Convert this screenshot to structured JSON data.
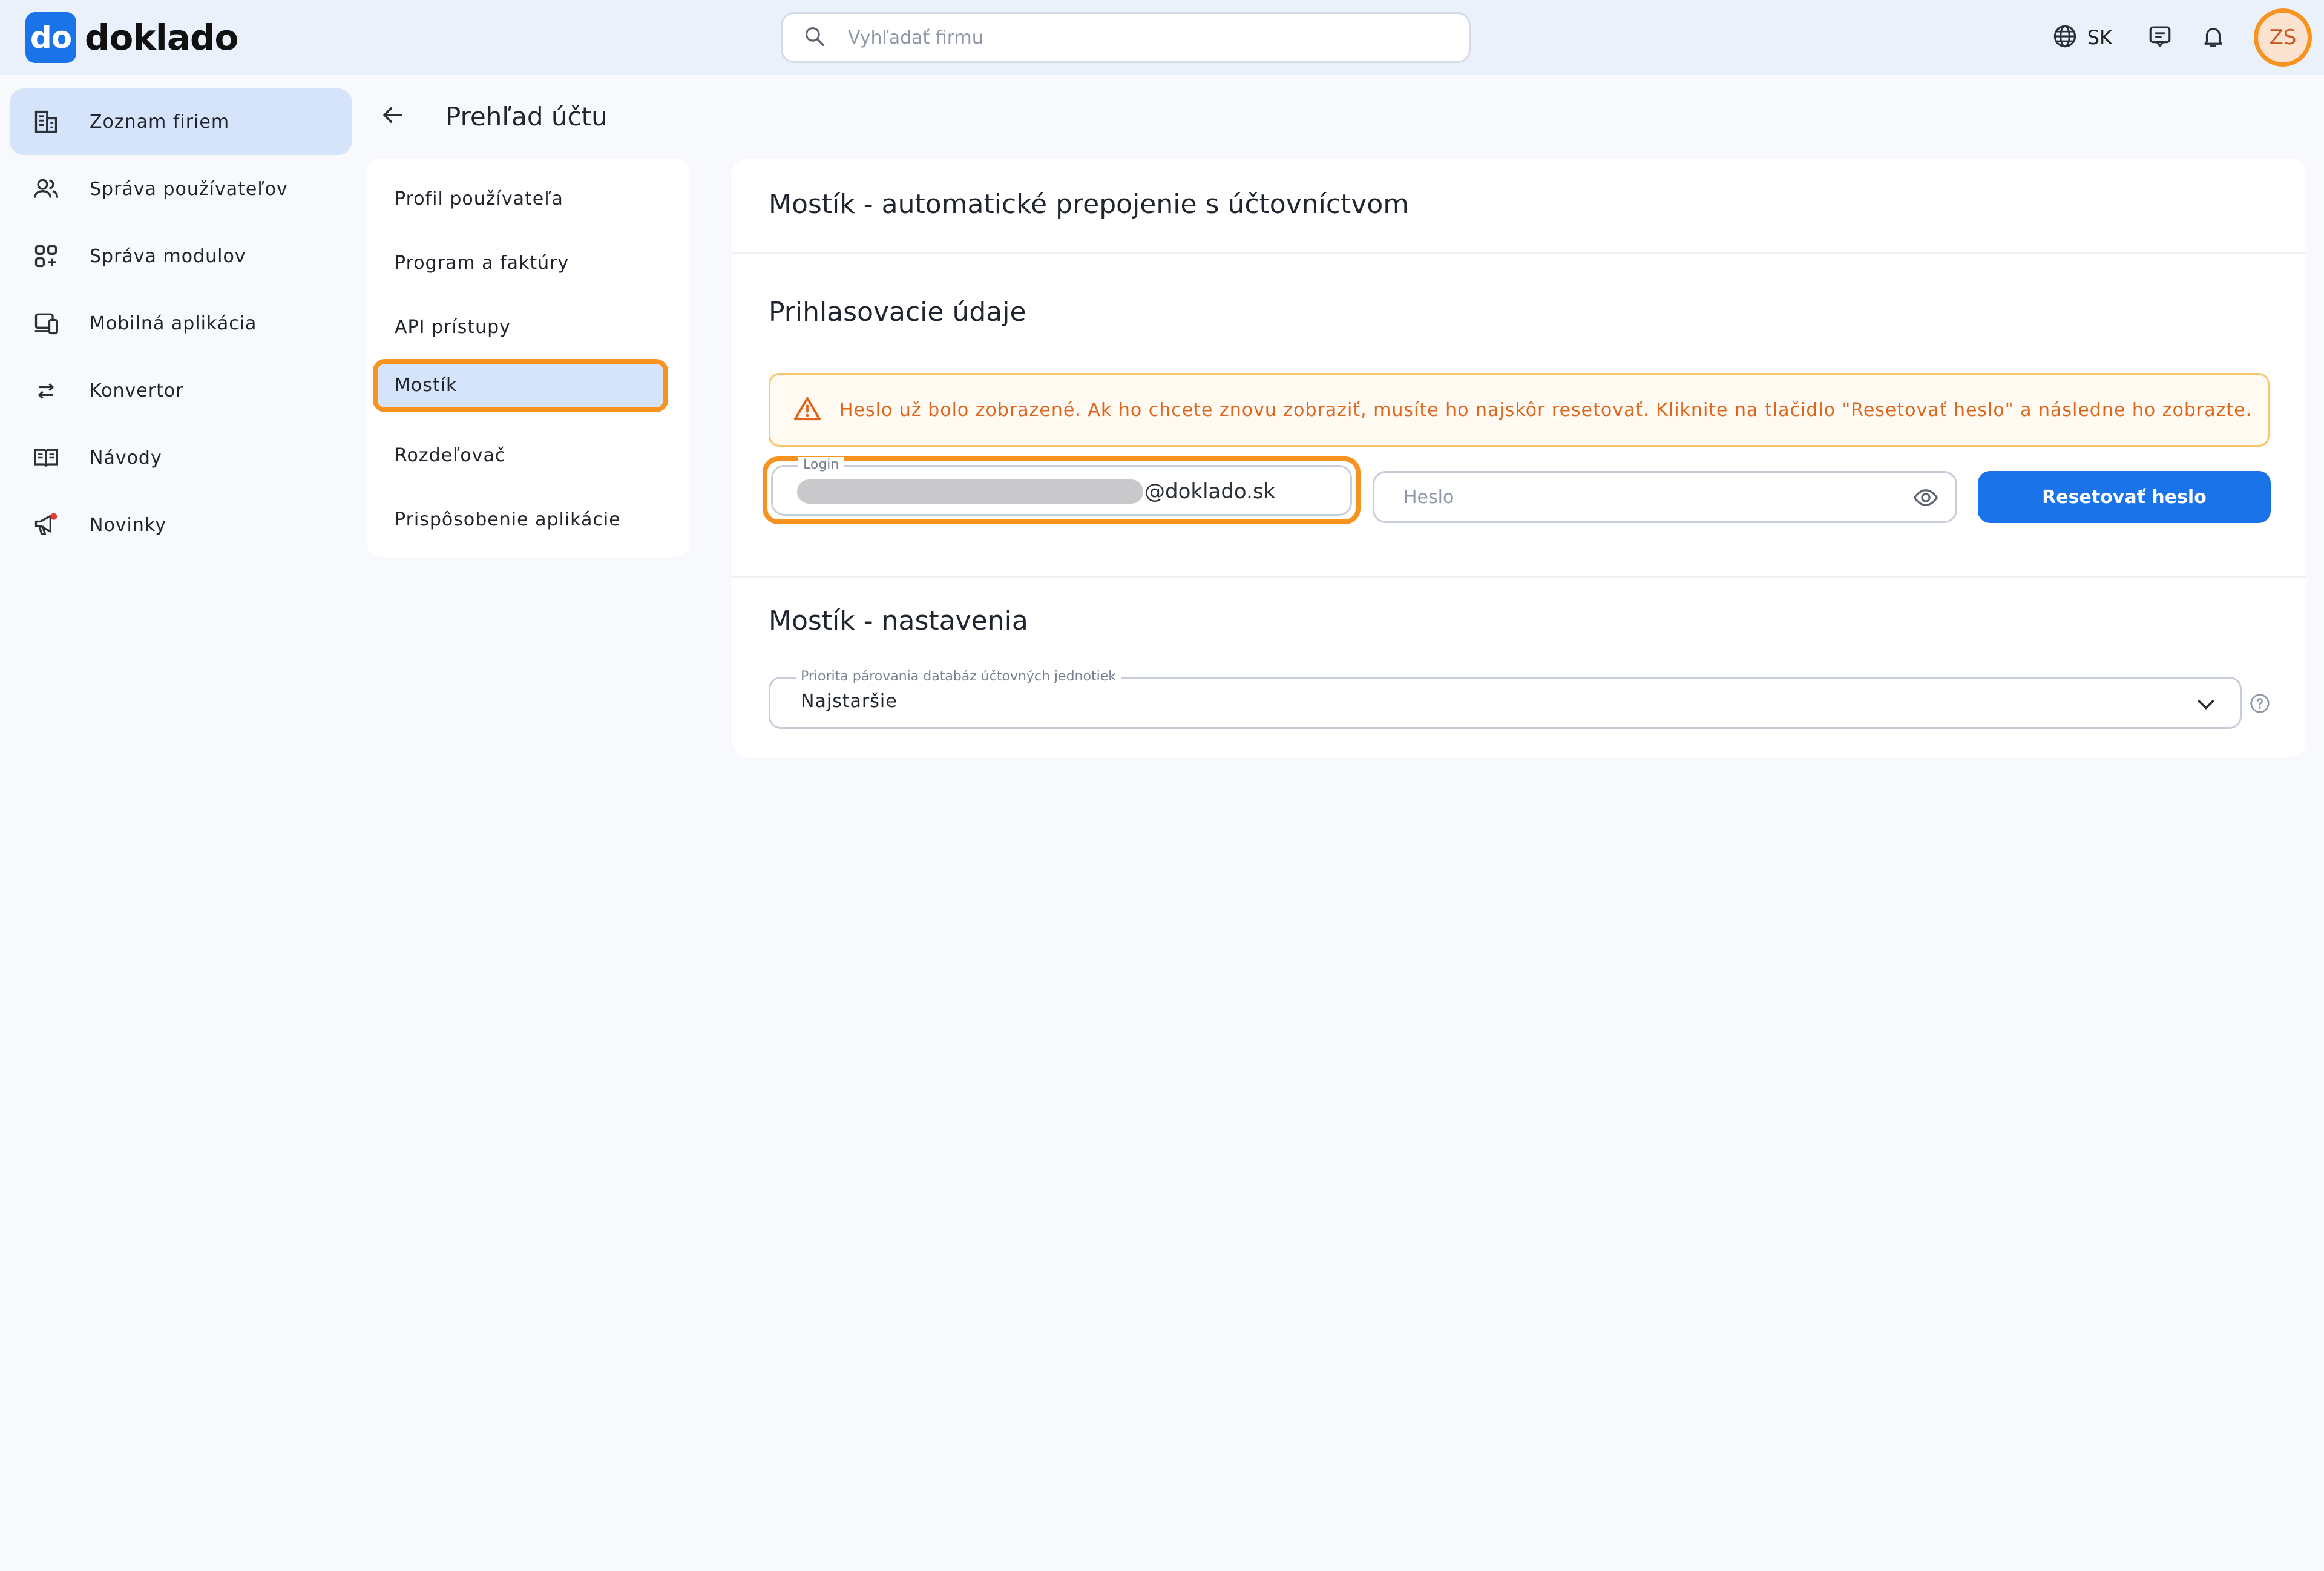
{
  "app": {
    "logo_badge": "do",
    "logo_text": "doklado",
    "brand_color": "#1a73e8",
    "accent_highlight": "#f7931e"
  },
  "header": {
    "search_placeholder": "Vyhľadať firmu",
    "language": "SK",
    "avatar_initials": "ZS"
  },
  "sidebar": {
    "items": [
      {
        "label": "Zoznam firiem",
        "icon": "buildings-icon",
        "active": true
      },
      {
        "label": "Správa používateľov",
        "icon": "users-icon"
      },
      {
        "label": "Správa modulov",
        "icon": "modules-icon"
      },
      {
        "label": "Mobilná aplikácia",
        "icon": "mobile-app-icon"
      },
      {
        "label": "Konvertor",
        "icon": "convert-arrows-icon"
      },
      {
        "label": "Návody",
        "icon": "book-icon"
      },
      {
        "label": "Novinky",
        "icon": "megaphone-icon"
      }
    ]
  },
  "page": {
    "title": "Prehľad účtu"
  },
  "submenu": {
    "items": [
      {
        "label": "Profil používateľa"
      },
      {
        "label": "Program a faktúry"
      },
      {
        "label": "API prístupy"
      },
      {
        "label": "Mostík",
        "active": true
      },
      {
        "label": "Rozdeľovač"
      },
      {
        "label": "Prispôsobenie aplikácie"
      }
    ]
  },
  "card": {
    "title": "Mostík - automatické prepojenie s účtovníctvom",
    "credentials": {
      "title": "Prihlasovacie údaje",
      "warning": "Heslo už bolo zobrazené. Ak ho chcete znovu zobraziť, musíte ho najskôr resetovať. Kliknite na tlačidlo \"Resetovať heslo\" a následne ho zobrazte.",
      "login_label": "Login",
      "login_domain": "@doklado.sk",
      "password_placeholder": "Heslo",
      "reset_button": "Resetovať heslo"
    },
    "settings": {
      "title": "Mostík - nastavenia",
      "priority_label": "Priorita párovania databáz účtovných jednotiek",
      "priority_value": "Najstaršie"
    }
  }
}
